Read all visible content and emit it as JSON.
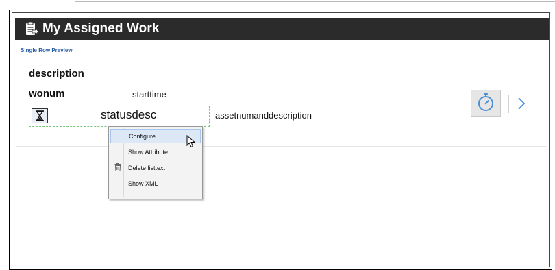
{
  "header": {
    "title": "My Assigned Work",
    "icon": "clipboard-arrow-icon"
  },
  "preview_label": "Single Row Preview",
  "row": {
    "description": "description",
    "wonum": "wonum",
    "starttime": "starttime",
    "status_icon": "hourglass-icon",
    "statusdesc": "statusdesc",
    "asset": "assetnumanddescription",
    "timer_icon": "stopwatch-icon",
    "next_icon": "chevron-right-icon"
  },
  "context_menu": {
    "items": [
      {
        "label": "Configure",
        "highlighted": true
      },
      {
        "label": "Show Attribute"
      },
      {
        "label": "Delete listtext",
        "icon": "trash-icon"
      },
      {
        "label": "Show XML"
      }
    ]
  },
  "colors": {
    "header_bg": "#2b2b2b",
    "preview_label": "#2b5da6",
    "selection_border": "#7bc47b",
    "menu_highlight": "#dce8f6",
    "timer_icon": "#4a90d9"
  }
}
